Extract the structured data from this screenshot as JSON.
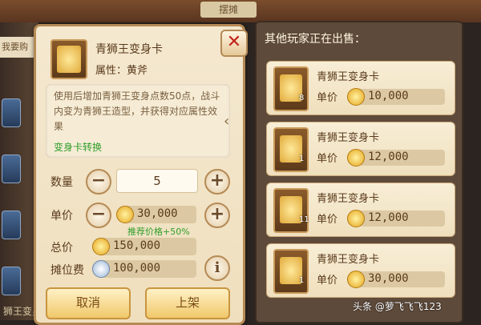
{
  "background": {
    "top_title": "摆摊",
    "left_tab": "我要购",
    "bottom_text": "狮王变身卡"
  },
  "sell_panel": {
    "item_name": "青狮王变身卡",
    "attribute": "属性：黄斧",
    "description": "使用后增加青狮王变身点数50点，战斗内变为青狮王造型，并获得对应属性效果",
    "transform_link": "变身卡转换",
    "quantity_label": "数量",
    "quantity_value": "5",
    "unit_price_label": "单价",
    "unit_price_value": "30,000",
    "recommended_text": "推荐价格+50%",
    "total_label": "总价",
    "total_value": "150,000",
    "booth_fee_label": "摊位费",
    "booth_fee_value": "100,000",
    "cancel_label": "取消",
    "list_label": "上架",
    "icons": {
      "close": "close-icon",
      "minus": "minus-icon",
      "plus": "plus-icon",
      "info": "info-icon",
      "coin": "gold-coin-icon"
    }
  },
  "market_panel": {
    "title": "其他玩家正在出售：",
    "unit_price_label": "单价",
    "listings": [
      {
        "name": "青狮王变身卡",
        "qty": "8",
        "price": "10,000"
      },
      {
        "name": "青狮王变身卡",
        "qty": "1",
        "price": "12,000"
      },
      {
        "name": "青狮王变身卡",
        "qty": "11",
        "price": "12,000"
      },
      {
        "name": "青狮王变身卡",
        "qty": "1",
        "price": "30,000"
      }
    ]
  },
  "watermark": "头条 @萝飞飞飞123",
  "colors": {
    "panel_bg": "#f4e8cf",
    "panel_border": "#b58a55",
    "green_text": "#2f9e2a",
    "close_red": "#c0221a",
    "market_bg": "#5e4a3a"
  }
}
